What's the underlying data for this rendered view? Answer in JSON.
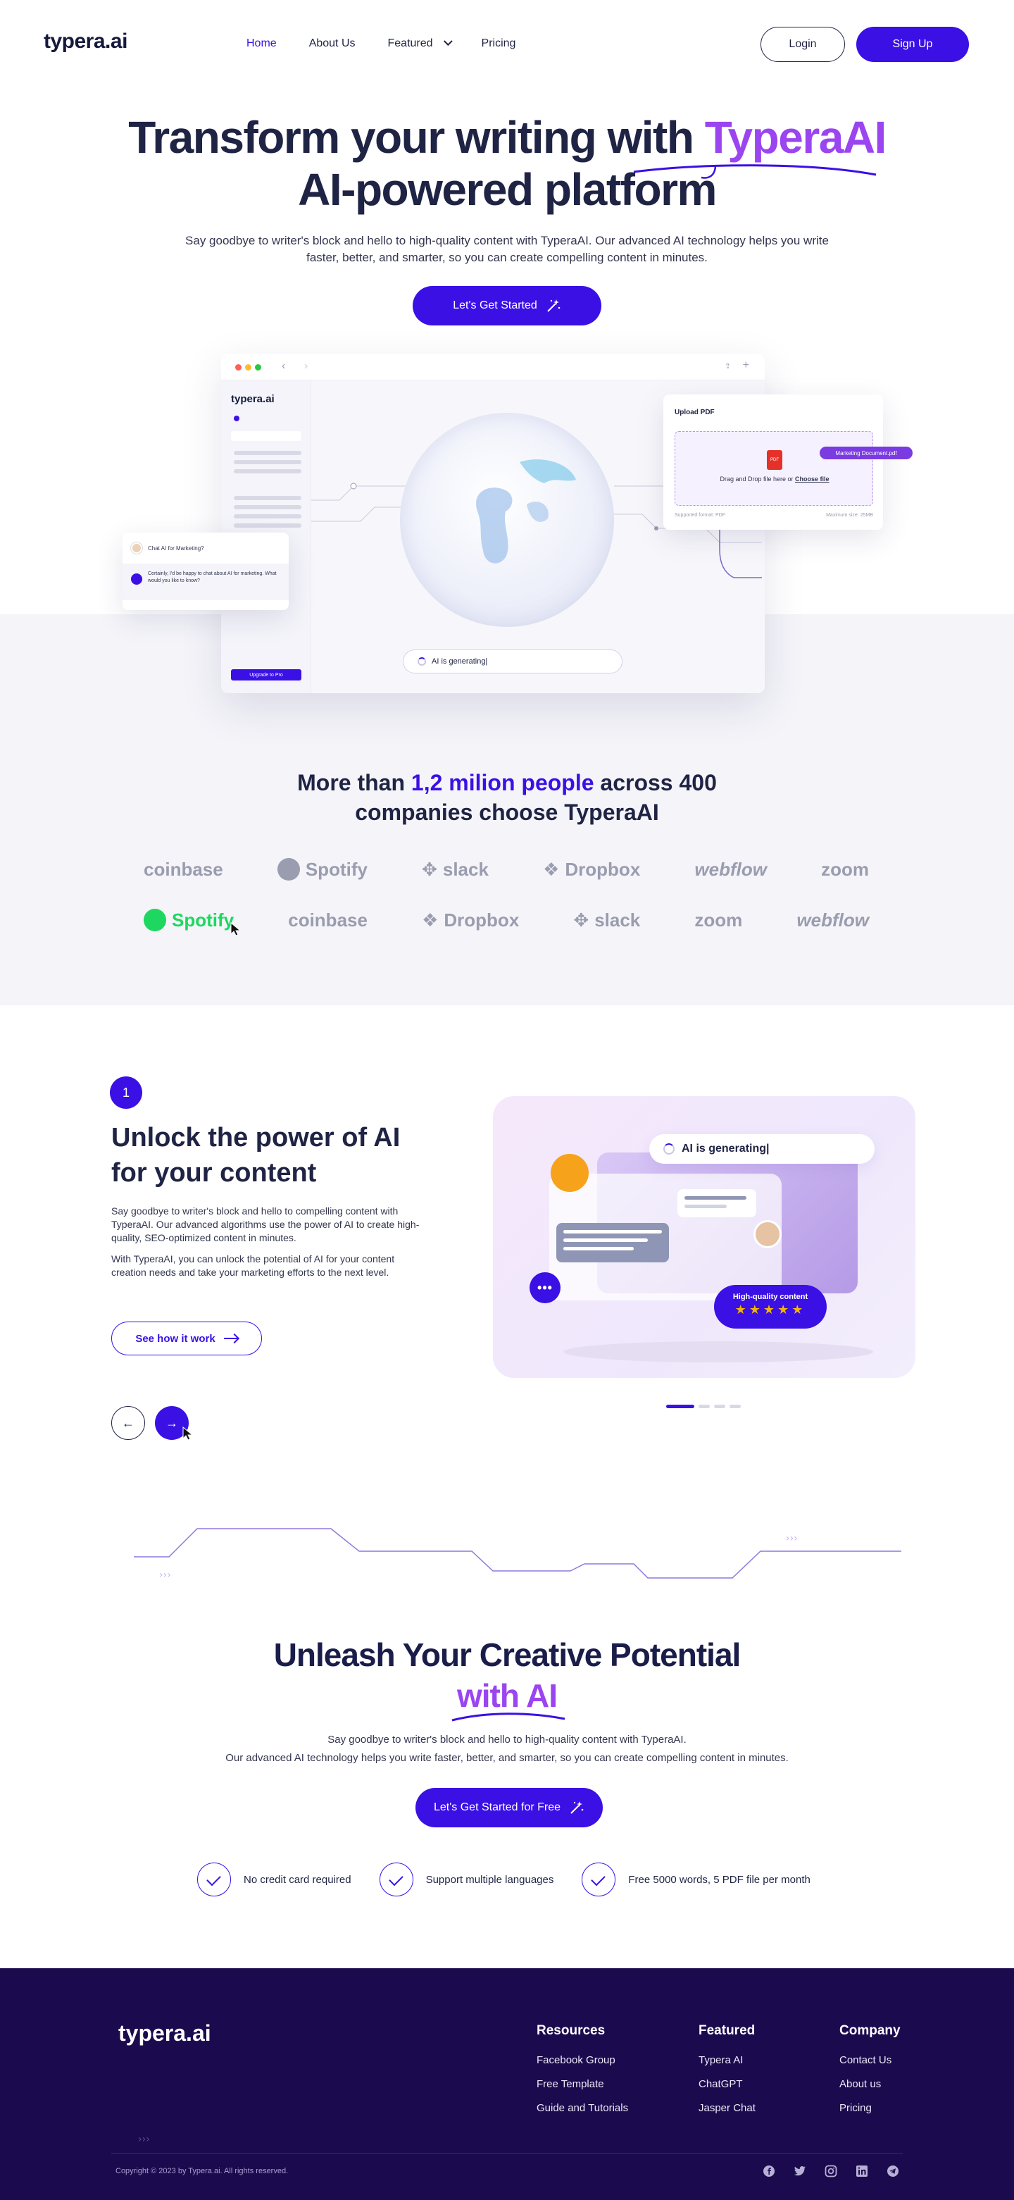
{
  "nav": {
    "logo": "typera.ai",
    "links": [
      "Home",
      "About Us",
      "Featured",
      "Pricing"
    ],
    "login": "Login",
    "signup": "Sign Up"
  },
  "hero": {
    "title_line1_a": "Transform your writing with ",
    "title_line1_b": "TyperaAI",
    "title_line2": "AI-powered platform",
    "subtitle": "Say goodbye to writer's block and hello to high-quality content with TyperaAI. Our advanced AI technology helps you write faster, better, and smarter, so you can create compelling content in minutes.",
    "cta": "Let's Get Started"
  },
  "mockup": {
    "app_logo": "typera.ai",
    "upgrade": "Upgrade to Pro",
    "generating": "AI is generating|",
    "upload_title": "Upload PDF",
    "drop_text": "Drag and Drop file here or ",
    "choose_file": "Choose file",
    "supported": "Supported format: PDF",
    "max_size": "Maximum size: 25MB",
    "pdf_label": "PDF",
    "file_chip": "Marketing Document.pdf",
    "chat_question": "Chat AI for Marketing?",
    "chat_answer": "Certainly, I'd be happy to chat about AI for marketing. What would you like to know?"
  },
  "companies": {
    "title_a": "More than ",
    "title_hl": "1,2 milion people",
    "title_b": " across 400",
    "title_line2": "companies choose TyperaAI",
    "row1": [
      "coinbase",
      "Spotify",
      "slack",
      "Dropbox",
      "webflow",
      "zoom"
    ],
    "row2": [
      "Spotify",
      "coinbase",
      "Dropbox",
      "slack",
      "zoom",
      "webflow"
    ]
  },
  "feature": {
    "number": "1",
    "title": "Unlock the power of AI for your content",
    "p1": "Say goodbye to writer's block and hello to compelling content with TyperaAI. Our advanced algorithms use the power of AI to create high-quality, SEO-optimized content in minutes.",
    "p2": "With TyperaAI, you can unlock the potential of AI for your content creation needs and take your marketing efforts to the next level.",
    "button": "See how it work",
    "illus_generating": "AI is generating|",
    "hq_label": "High-quality content",
    "stars": "★★★★★",
    "dots": "•••",
    "prev_icon": "←",
    "next_icon": "→",
    "pager_total": 4,
    "pager_active": 1
  },
  "cta": {
    "title_line1": "Unleash Your Creative Potential",
    "title_line2": "with AI",
    "p1": "Say goodbye to writer's block and hello to high-quality content with TyperaAI.",
    "p2": "Our advanced AI technology helps you write faster, better, and smarter, so you can create compelling content in minutes.",
    "button": "Let's Get Started for Free",
    "features": [
      "No credit card required",
      "Support multiple languages",
      "Free 5000 words, 5 PDF file per month"
    ]
  },
  "footer": {
    "logo": "typera.ai",
    "resources_title": "Resources",
    "resources": [
      "Facebook Group",
      "Free Template",
      "Guide and Tutorials"
    ],
    "featured_title": "Featured",
    "featured": [
      "Typera AI",
      "ChatGPT",
      "Jasper Chat"
    ],
    "company_title": "Company",
    "company": [
      "Contact Us",
      "About us",
      "Pricing"
    ],
    "copyright": "Copyright © 2023 by Typera.ai. All rights reserved.",
    "socials": [
      "facebook-icon",
      "twitter-icon",
      "instagram-icon",
      "linkedin-icon",
      "telegram-icon"
    ]
  },
  "colors": {
    "brand": "#3a10e5",
    "accent": "#9a45f0",
    "footer_bg": "#1c0a4f",
    "text": "#1f2344"
  }
}
